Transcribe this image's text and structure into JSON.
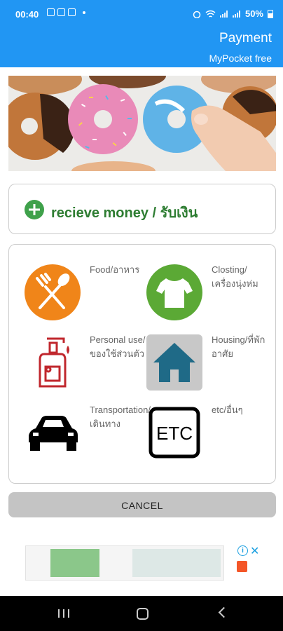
{
  "status": {
    "time": "00:40",
    "battery": "50%"
  },
  "appbar": {
    "title": "Payment",
    "subtitle": "MyPocket free"
  },
  "receive": {
    "label": "recieve money / รับเงิน"
  },
  "categories": [
    {
      "label": "Food/อาหาร",
      "icon": "fork-spoon-icon"
    },
    {
      "label": "Closting/เครื่องนุ่งห่ม",
      "icon": "shirt-icon"
    },
    {
      "label": "Personal use/ของใช้ส่วนตัว",
      "icon": "soap-dispenser-icon"
    },
    {
      "label": "Housing/ที่พักอาศัย",
      "icon": "house-icon"
    },
    {
      "label": "Transportation/เดินทาง",
      "icon": "car-icon"
    },
    {
      "label": "etc/อื่นๆ",
      "icon": "etc-icon"
    }
  ],
  "etc_icon_text": "ETC",
  "cancel": {
    "label": "CANCEL"
  },
  "colors": {
    "primary": "#2196f3",
    "receive_green": "#2e7d32",
    "food_orange": "#f08519",
    "clothing_green": "#5ba935",
    "housing_blue": "#1f6a87"
  }
}
